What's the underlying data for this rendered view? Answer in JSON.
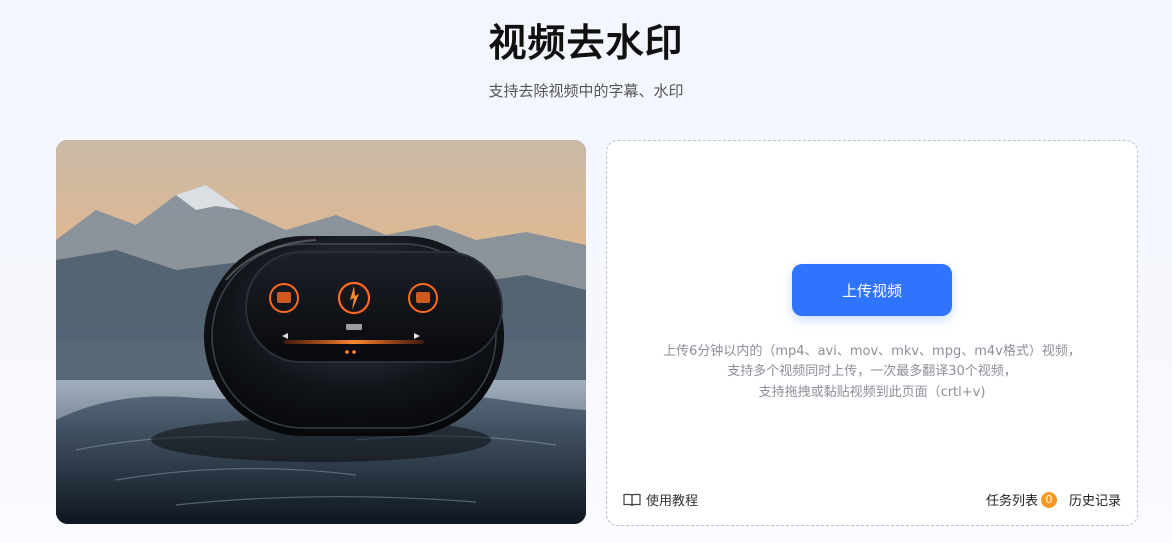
{
  "header": {
    "title": "视频去水印",
    "subtitle": "支持去除视频中的字幕、水印"
  },
  "upload": {
    "button_label": "上传视频",
    "hint_line1": "上传6分钟以内的（mp4、avi、mov、mkv、mpg、m4v格式）视频，",
    "hint_line2": "支持多个视频同时上传，一次最多翻译30个视频，",
    "hint_line3": "支持拖拽或黏贴视频到此页面（crtl+v)"
  },
  "footer": {
    "tutorial_label": "使用教程",
    "task_list_label": "任务列表",
    "task_count": "0",
    "history_label": "历史记录"
  },
  "colors": {
    "accent": "#2f74ff",
    "badge": "#f59a23"
  }
}
